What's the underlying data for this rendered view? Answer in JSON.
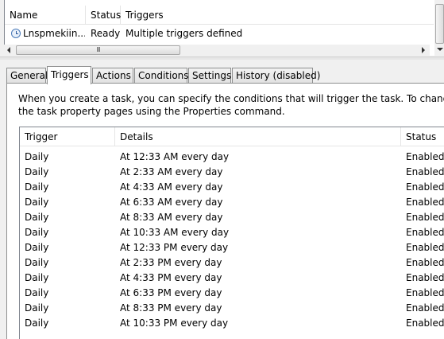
{
  "task_list": {
    "columns": [
      "Name",
      "Status",
      "Triggers"
    ],
    "row": {
      "icon": "clock-icon",
      "name": "Lnspmekiin...",
      "status": "Ready",
      "triggers": "Multiple triggers defined"
    },
    "hscroll_grip": "III"
  },
  "tabs": [
    {
      "label": "General",
      "active": false
    },
    {
      "label": "Triggers",
      "active": true
    },
    {
      "label": "Actions",
      "active": false
    },
    {
      "label": "Conditions",
      "active": false
    },
    {
      "label": "Settings",
      "active": false
    },
    {
      "label": "History (disabled)",
      "active": false
    }
  ],
  "triggers_tab": {
    "description_line1": "When you create a task, you can specify the conditions that will trigger the task.  To change these trig",
    "description_line2": "the task property pages using the Properties command.",
    "columns": [
      "Trigger",
      "Details",
      "Status"
    ],
    "rows": [
      {
        "trigger": "Daily",
        "details": "At 12:33 AM every day",
        "status": "Enabled"
      },
      {
        "trigger": "Daily",
        "details": "At 2:33 AM every day",
        "status": "Enabled"
      },
      {
        "trigger": "Daily",
        "details": "At 4:33 AM every day",
        "status": "Enabled"
      },
      {
        "trigger": "Daily",
        "details": "At 6:33 AM every day",
        "status": "Enabled"
      },
      {
        "trigger": "Daily",
        "details": "At 8:33 AM every day",
        "status": "Enabled"
      },
      {
        "trigger": "Daily",
        "details": "At 10:33 AM every day",
        "status": "Enabled"
      },
      {
        "trigger": "Daily",
        "details": "At 12:33 PM every day",
        "status": "Enabled"
      },
      {
        "trigger": "Daily",
        "details": "At 2:33 PM every day",
        "status": "Enabled"
      },
      {
        "trigger": "Daily",
        "details": "At 4:33 PM every day",
        "status": "Enabled"
      },
      {
        "trigger": "Daily",
        "details": "At 6:33 PM every day",
        "status": "Enabled"
      },
      {
        "trigger": "Daily",
        "details": "At 8:33 PM every day",
        "status": "Enabled"
      },
      {
        "trigger": "Daily",
        "details": "At 10:33 PM every day",
        "status": "Enabled"
      }
    ]
  }
}
